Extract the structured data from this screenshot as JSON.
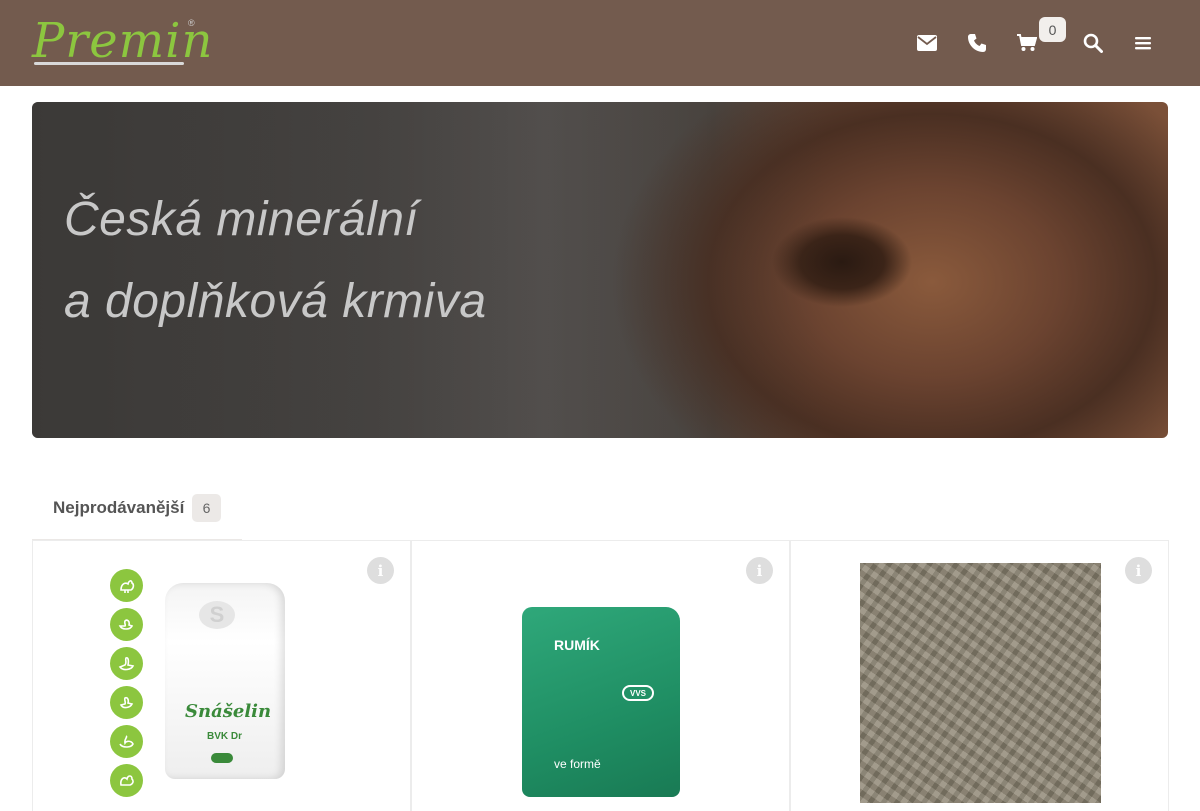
{
  "header": {
    "logo_text": "Premin",
    "logo_reg": "®",
    "icons": [
      "envelope-icon",
      "phone-icon",
      "cart-icon",
      "search-icon",
      "menu-icon"
    ],
    "cart_count": "0",
    "background_color": "#735b4e",
    "accent_color": "#8cc63f"
  },
  "hero": {
    "line1": "Česká minerální",
    "line2": "a doplňková krmiva"
  },
  "tabs": [
    {
      "label": "Nejprodávanější",
      "count": "6"
    }
  ],
  "products": [
    {
      "image": "snaselin-bag",
      "bag_text": "Snášelin",
      "bag_sub": "BVK Dr",
      "info_icon": "info-icon"
    },
    {
      "image": "rumik-bag",
      "bag_text": "RUMÍK",
      "bag_sub": "ve formě",
      "info_icon": "info-icon"
    },
    {
      "image": "pellets",
      "info_icon": "info-icon"
    }
  ]
}
